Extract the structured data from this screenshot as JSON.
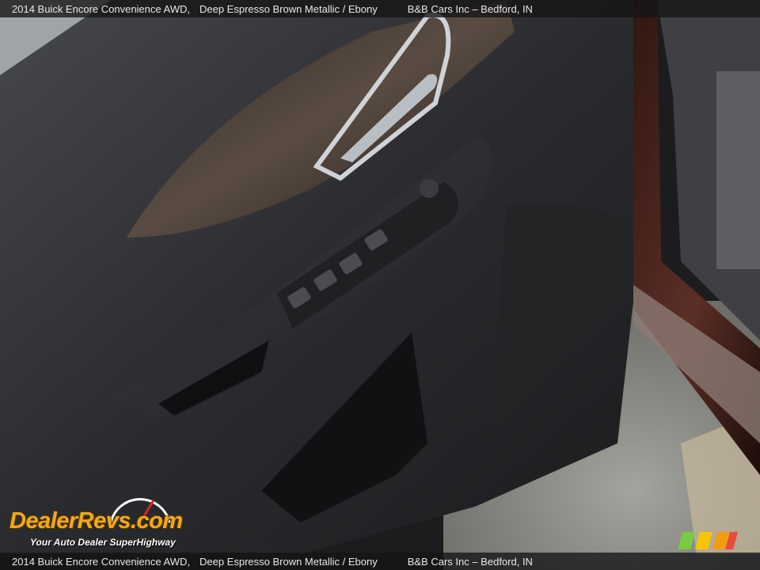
{
  "caption": {
    "title": "2014 Buick Encore Convenience AWD,",
    "color": "Deep Espresso Brown Metallic / Ebony",
    "dealer": "B&B Cars Inc – Bedford, IN"
  },
  "watermark": {
    "logo_text": "DealerRevs.com",
    "tagline": "Your Auto Dealer SuperHighway"
  },
  "photo": {
    "subject": "door-panel-interior",
    "colors": {
      "panel": "#2a2b2e",
      "trim": "#3a3028",
      "chrome": "#cfd3d8",
      "paint": "#3b1e18",
      "pavement": "#8a8a86"
    }
  }
}
